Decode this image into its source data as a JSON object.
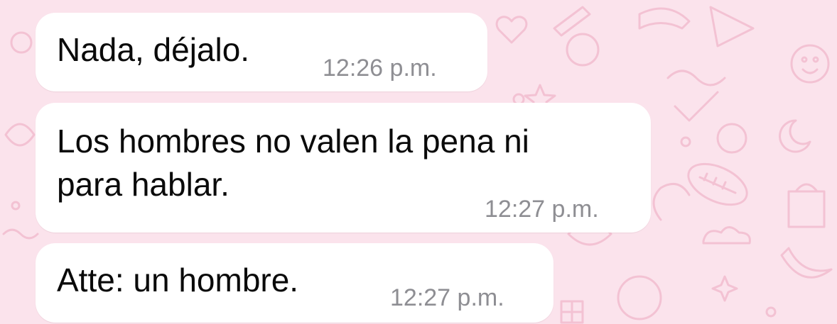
{
  "theme": {
    "wallpaper_color": "#fbe3ec",
    "doodle_color": "#f3c2d3",
    "bubble_color": "#ffffff",
    "text_color": "#0a0a0a",
    "time_color": "#8e8e93"
  },
  "messages": [
    {
      "lines": [
        "Nada, déjalo."
      ],
      "time": "12:26 p.m."
    },
    {
      "lines": [
        "Los hombres no valen la pena ni",
        "para hablar."
      ],
      "time": "12:27 p.m."
    },
    {
      "lines": [
        "Atte: un hombre."
      ],
      "time": "12:27 p.m."
    }
  ]
}
